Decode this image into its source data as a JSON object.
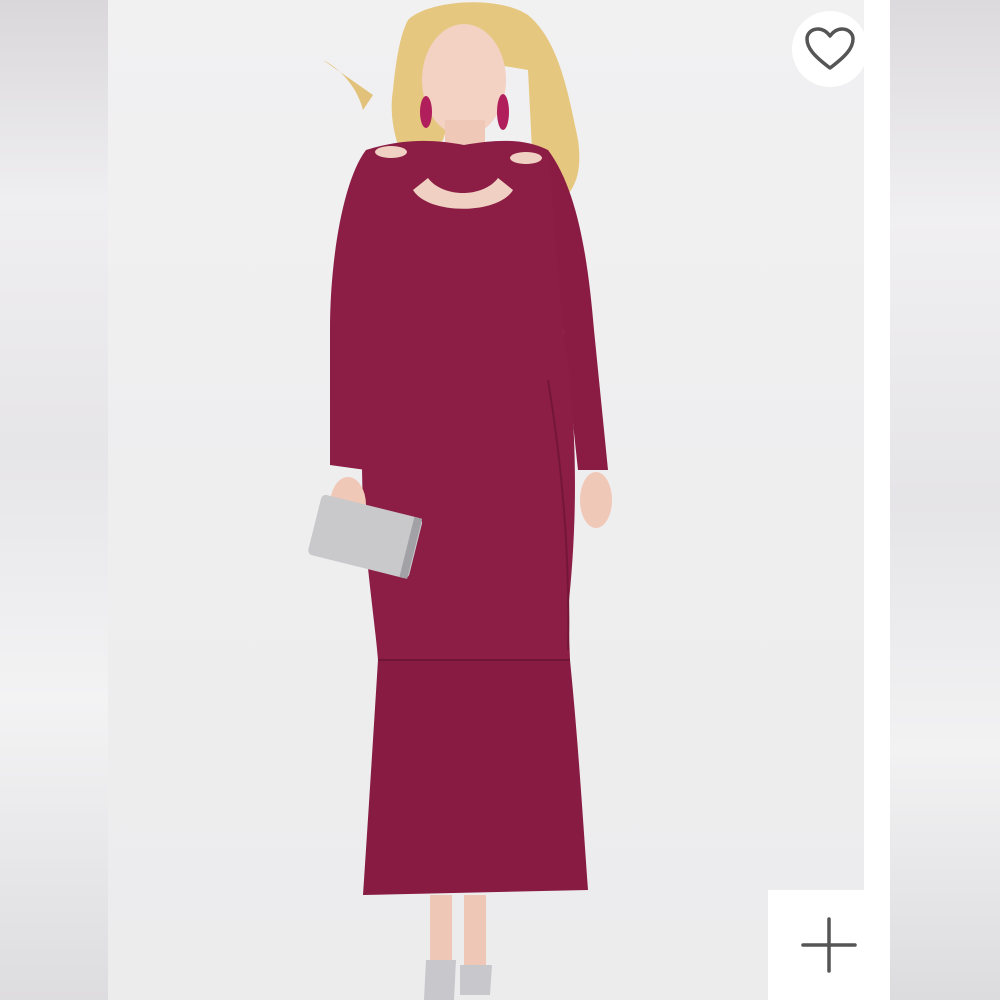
{
  "image": {
    "alt": "Model wearing a long-sleeve burgundy maxi dress with cutout neckline and flounce hem, holding a silver sequin clutch",
    "dress_color": "#8c1d45",
    "background_color": "#efeff0"
  },
  "actions": {
    "wishlist": {
      "icon": "heart-outline-icon",
      "label": "Add to wishlist"
    },
    "add": {
      "icon": "plus-icon",
      "label": "Add"
    }
  },
  "colors": {
    "icon": "#555555",
    "button_bg": "#ffffff"
  }
}
